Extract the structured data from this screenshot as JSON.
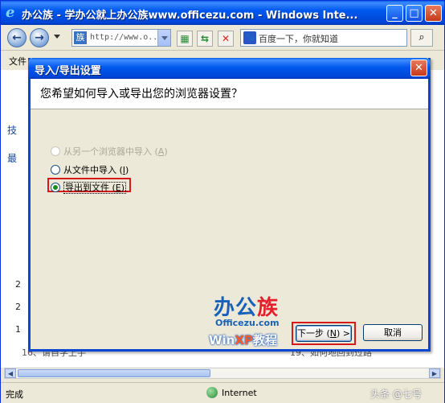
{
  "browser": {
    "title": "办公族 - 学办公就上办公族www.officezu.com - Windows Inte...",
    "address": "http://www.o...",
    "search_text": "百度一下，你就知道",
    "menu_first": "文件",
    "status_left": "完成",
    "status_zone": "Internet",
    "content_side": [
      "技",
      "最"
    ],
    "content_list": [
      "2",
      "2",
      "1"
    ],
    "bottom_left": "16、请自学上手",
    "bottom_right": "19、如何地回到过路",
    "watermark": "头条 @七号"
  },
  "dialog": {
    "title": "导入/导出设置",
    "question": "您希望如何导入或导出您的浏览器设置？",
    "options": [
      {
        "label": "从另一个浏览器中导入",
        "key": "A",
        "state": "disabled"
      },
      {
        "label": "从文件中导入",
        "key": "I",
        "state": "enabled"
      },
      {
        "label": "导出到文件",
        "key": "E",
        "state": "selected"
      }
    ],
    "next_label": "下一步",
    "next_key": "N",
    "next_arrow": ">",
    "cancel_label": "取消",
    "logo": {
      "main": "办公",
      "highlight": "族",
      "url": "Officezu.com",
      "winxp_a": "Win",
      "winxp_b": "XP",
      "winxp_c": "教程"
    }
  },
  "colors": {
    "titlebar": "#0058ee",
    "highlight_box": "#d61a1a"
  }
}
